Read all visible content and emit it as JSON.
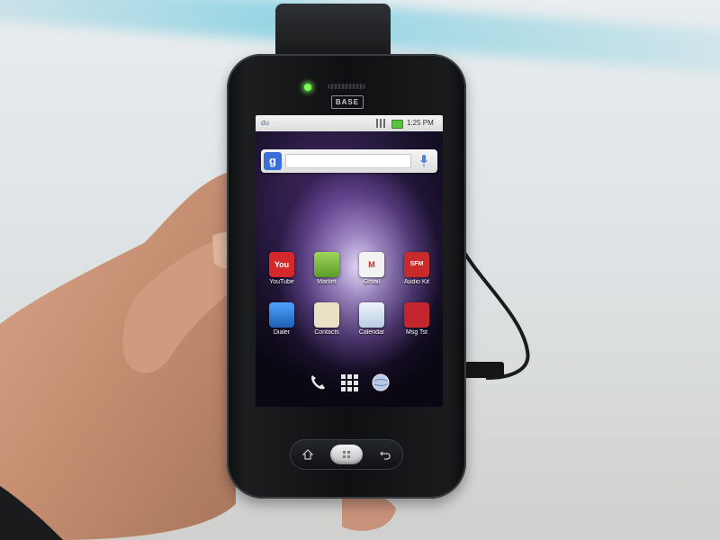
{
  "device": {
    "brand": "BASE"
  },
  "statusbar": {
    "carrier": "du",
    "signal_icon": "signal-icon",
    "battery_icon": "battery-icon",
    "time": "1:25 PM"
  },
  "search": {
    "logo": "g",
    "placeholder": "",
    "mic_icon": "microphone-icon"
  },
  "apps": [
    {
      "label": "YouTube",
      "icon": "youtube-icon",
      "glyph": "You",
      "color": "#d4282a"
    },
    {
      "label": "Market",
      "icon": "market-icon",
      "glyph": "",
      "color": "#7fbf3f"
    },
    {
      "label": "Gmail",
      "icon": "gmail-icon",
      "glyph": "M",
      "color": "#f2f2f2"
    },
    {
      "label": "Audio Kit",
      "icon": "sfm-icon",
      "glyph": "SFM",
      "color": "#c92a2a"
    },
    {
      "label": "Dialer",
      "icon": "dialer-icon",
      "glyph": "",
      "color": "#2a7fd8"
    },
    {
      "label": "Contacts",
      "icon": "contacts-icon",
      "glyph": "",
      "color": "#e8e1c6"
    },
    {
      "label": "Calendar",
      "icon": "calendar-icon",
      "glyph": "",
      "color": "#d9e6f2"
    },
    {
      "label": "Msg Tst",
      "icon": "messaging-icon",
      "glyph": "",
      "color": "#c3262e"
    }
  ],
  "dockbar": {
    "left": "phone-icon",
    "center": "app-drawer-icon",
    "right": "browser-icon"
  },
  "hardware": {
    "left_key": "home-key-icon",
    "center_key": "menu-key-icon",
    "right_key": "back-key-icon"
  },
  "colors": {
    "led": "#7dff5a",
    "accent_band": "#78cde1",
    "phone_body": "#0f1011"
  }
}
